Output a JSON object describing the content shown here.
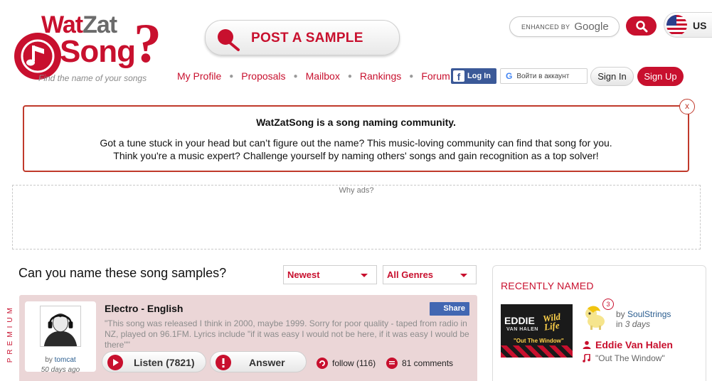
{
  "logo": {
    "word1": "Wat",
    "word2": "Zat",
    "word3": "Song",
    "mark": "?",
    "tagline": "Find the name of your songs"
  },
  "header": {
    "post_button": "POST A SAMPLE",
    "search": {
      "enhanced_by": "ENHANCED BY",
      "brand": "Google"
    },
    "country": "US"
  },
  "nav": [
    "My Profile",
    "Proposals",
    "Mailbox",
    "Rankings",
    "Forum"
  ],
  "auth": {
    "facebook": "Log In",
    "google": "Войти в аккаунт",
    "sign_in": "Sign In",
    "sign_up": "Sign Up"
  },
  "info": {
    "title": "WatZatSong is a song naming community.",
    "line1": "Got a tune stuck in your head but can’t figure out the name? This music-loving community can find that song for you.",
    "line2": "Think you're a music expert? Challenge yourself by naming others' songs and gain recognition as a top solver!",
    "close": "x"
  },
  "ads": {
    "why": "Why ads?"
  },
  "samples": {
    "title": "Can you name these song samples?",
    "sort": "Newest",
    "genre_filter": "All Genres",
    "premium_label": "PREMIUM",
    "items": [
      {
        "genre": "Electro - English",
        "share": "Share",
        "description": "\"This song was released I think in 2000, maybe 1999. Sorry for poor quality - taped from radio in NZ, played on 96.1FM. Lyrics include \"if it was easy I would not be here, if it was easy I would be there\"\"",
        "by_prefix": "by",
        "user": "tomcat",
        "ago": "50 days ago",
        "listen": "Listen (7821)",
        "answer": "Answer",
        "follow": "follow (116)",
        "comments": "81 comments"
      }
    ]
  },
  "recent": {
    "title": "RECENTLY NAMED",
    "album": {
      "line1": "EDDIE",
      "line2": "VAN HALEN",
      "wild": "Wild Life",
      "sub": "\"Out The Window\""
    },
    "badge": "3",
    "by_prefix": "by",
    "user": "SoulStrings",
    "in_prefix": "in",
    "days": "3 days",
    "artist": "Eddie Van Halen",
    "song": "\"Out The Window\""
  },
  "colors": {
    "brand": "#c8102e",
    "link": "#2a5d8f",
    "facebook": "#3b5998"
  }
}
